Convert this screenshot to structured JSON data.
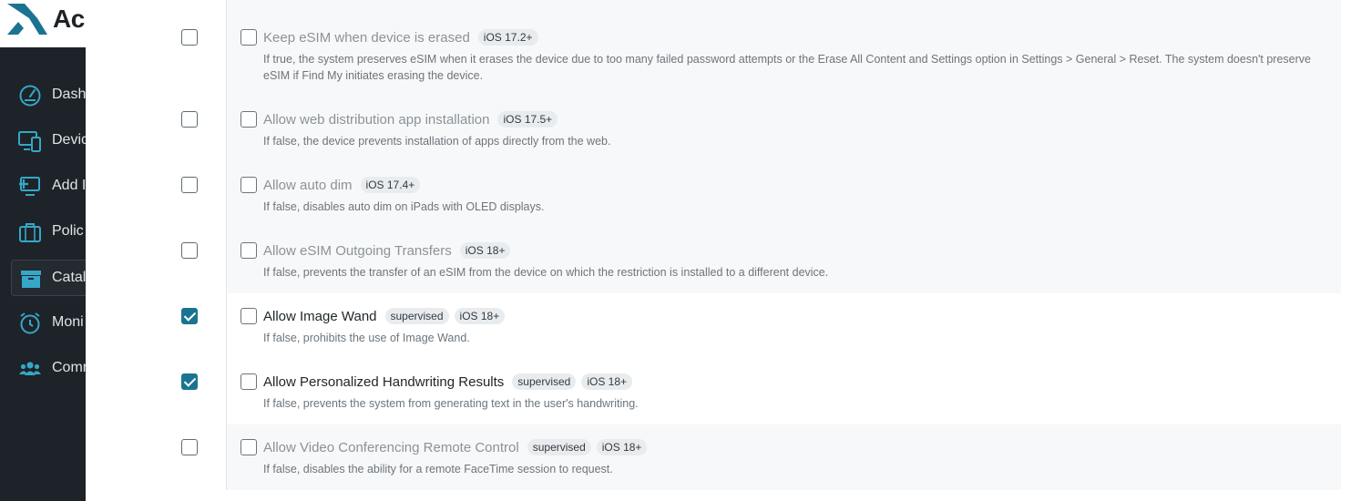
{
  "brand": {
    "name": "Ac"
  },
  "nav": [
    {
      "label": "Dash",
      "icon": "gauge-icon"
    },
    {
      "label": "Devic",
      "icon": "devices-icon"
    },
    {
      "label": "Add I",
      "icon": "add-device-icon"
    },
    {
      "label": "Polic",
      "icon": "briefcase-icon"
    },
    {
      "label": "Catal",
      "icon": "archive-box-icon",
      "active": true
    },
    {
      "label": "Moni",
      "icon": "alarm-clock-icon"
    },
    {
      "label": "Comr",
      "icon": "users-icon"
    }
  ],
  "colors": {
    "sidebar": "#1d2328",
    "accent": "#1a7491",
    "tag_bg": "#e9ecee"
  },
  "restrictions": [
    {
      "title": "Keep eSIM when device is erased",
      "tags": [
        "iOS 17.2+"
      ],
      "description": "If true, the system preserves eSIM when it erases the device due to too many failed password attempts or the Erase All Content and Settings option in Settings > General > Reset. The system doesn't preserve eSIM if Find My initiates erasing the device.",
      "selected": false
    },
    {
      "title": "Allow web distribution app installation",
      "tags": [
        "iOS 17.5+"
      ],
      "description": "If false, the device prevents installation of apps directly from the web.",
      "selected": false
    },
    {
      "title": "Allow auto dim",
      "tags": [
        "iOS 17.4+"
      ],
      "description": "If false, disables auto dim on iPads with OLED displays.",
      "selected": false
    },
    {
      "title": "Allow eSIM Outgoing Transfers",
      "tags": [
        "iOS 18+"
      ],
      "description": "If false, prevents the transfer of an eSIM from the device on which the restriction is installed to a different device.",
      "selected": false
    },
    {
      "title": "Allow Image Wand",
      "tags": [
        "supervised",
        "iOS 18+"
      ],
      "description": "If false, prohibits the use of Image Wand.",
      "selected": true
    },
    {
      "title": "Allow Personalized Handwriting Results",
      "tags": [
        "supervised",
        "iOS 18+"
      ],
      "description": "If false, prevents the system from generating text in the user's handwriting.",
      "selected": true
    },
    {
      "title": "Allow Video Conferencing Remote Control",
      "tags": [
        "supervised",
        "iOS 18+"
      ],
      "description": "If false, disables the ability for a remote FaceTime session to request.",
      "selected": false
    }
  ]
}
